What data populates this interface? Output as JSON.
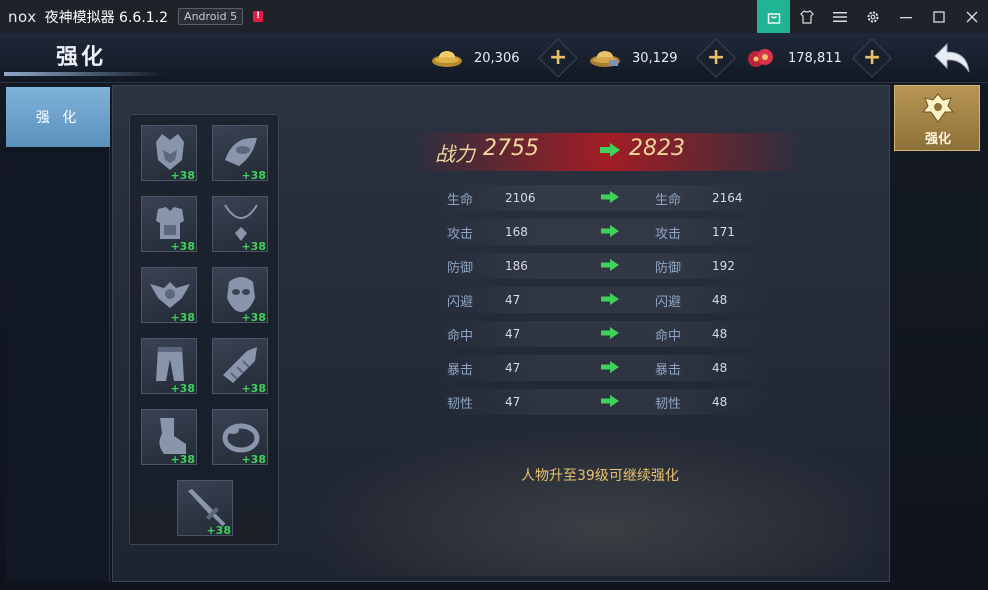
{
  "window": {
    "logo_text": "nox",
    "title": "夜神模拟器 6.6.1.2",
    "android_badge": "Android 5",
    "warning_badge": "!"
  },
  "header": {
    "page_title": "强化",
    "currencies": [
      {
        "name": "gold-ingot",
        "value": "20,306"
      },
      {
        "name": "silver-ingot",
        "value": "30,129"
      },
      {
        "name": "red-coin",
        "value": "178,811"
      }
    ]
  },
  "sidebar": {
    "active_tab": "强 化"
  },
  "right_panel": {
    "tab_label": "强化"
  },
  "equipment": {
    "slots": [
      {
        "icon": "helmet-icon",
        "level": "+38"
      },
      {
        "icon": "shoulder-icon",
        "level": "+38"
      },
      {
        "icon": "armor-icon",
        "level": "+38"
      },
      {
        "icon": "necklace-icon",
        "level": "+38"
      },
      {
        "icon": "belt-icon",
        "level": "+38"
      },
      {
        "icon": "mask-icon",
        "level": "+38"
      },
      {
        "icon": "pants-icon",
        "level": "+38"
      },
      {
        "icon": "bracer-icon",
        "level": "+38"
      },
      {
        "icon": "boots-icon",
        "level": "+38"
      },
      {
        "icon": "ring-icon",
        "level": "+38"
      },
      {
        "icon": "sword-icon",
        "level": "+38"
      }
    ]
  },
  "stats": {
    "power_label": "战力",
    "power_old": "2755",
    "power_new": "2823",
    "rows": [
      {
        "name": "生命",
        "old": "2106",
        "new": "2164"
      },
      {
        "name": "攻击",
        "old": "168",
        "new": "171"
      },
      {
        "name": "防御",
        "old": "186",
        "new": "192"
      },
      {
        "name": "闪避",
        "old": "47",
        "new": "48"
      },
      {
        "name": "命中",
        "old": "47",
        "new": "48"
      },
      {
        "name": "暴击",
        "old": "47",
        "new": "48"
      },
      {
        "name": "韧性",
        "old": "47",
        "new": "48"
      }
    ]
  },
  "notice": "人物升至39级可继续强化",
  "colors": {
    "accent_green": "#3fd15a",
    "gold_text": "#f0d79a",
    "tab_blue": "#7fb2d8"
  }
}
